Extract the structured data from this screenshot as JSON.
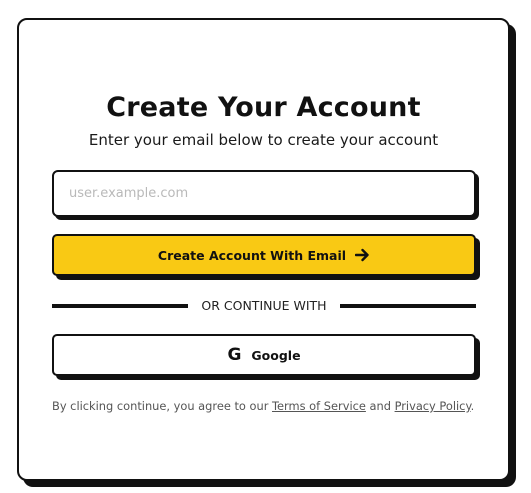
{
  "header": {
    "title": "Create Your Account",
    "subtitle": "Enter your email below to create your account"
  },
  "form": {
    "email_value": "",
    "email_placeholder": "user.example.com",
    "submit_label": "Create Account With Email",
    "submit_icon": "arrow-right-icon"
  },
  "divider": {
    "text": "OR CONTINUE WITH"
  },
  "google": {
    "icon": "google-icon",
    "icon_glyph": "G",
    "label": "Google"
  },
  "terms": {
    "prefix": "By clicking continue, you agree to our ",
    "terms_link": "Terms of Service",
    "middle": " and ",
    "privacy_link": "Privacy Policy",
    "suffix": "."
  },
  "colors": {
    "accent": "#f9c914",
    "border": "#111111",
    "background": "#ffffff",
    "muted_text": "#555555"
  }
}
